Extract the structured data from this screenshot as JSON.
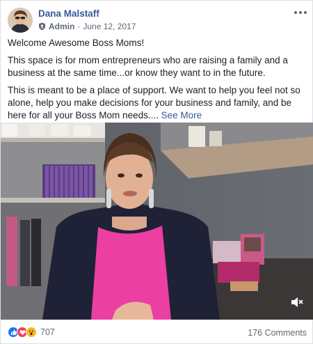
{
  "post": {
    "author": "Dana Malstaff",
    "role": "Admin",
    "separator": "·",
    "date": "June 12, 2017",
    "paragraphs": [
      "Welcome Awesome Boss Moms!",
      "This space is for mom entrepreneurs who are raising a family and a business at the same time...or know they want to in the future.",
      "This is meant to be a place of support. We want to help you feel not so alone, help you make decisions for your business and family, and be here for all your Boss Mom needs.... "
    ],
    "see_more": "See More"
  },
  "video": {
    "muted": true
  },
  "footer": {
    "reaction_count": "707",
    "comments": "176 Comments",
    "reactions": [
      "like-icon",
      "love-icon",
      "wow-icon"
    ]
  },
  "colors": {
    "link": "#385898",
    "muted_text": "#606770",
    "like": "#1877f2",
    "love": "#f33e58",
    "wow": "#f7b928"
  }
}
